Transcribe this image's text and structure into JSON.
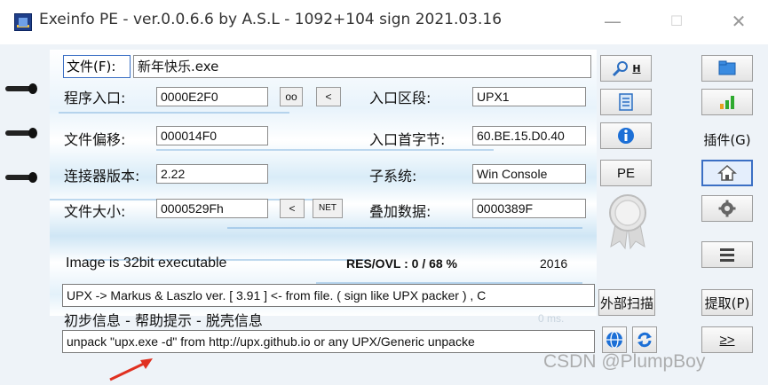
{
  "window": {
    "title": "Exeinfo PE - ver.0.0.6.6  by A.S.L -  1092+104 sign  2021.03.16",
    "minimize": "—",
    "maximize": "☐",
    "close": "✕"
  },
  "file": {
    "button_label": "文件(F):",
    "name": "新年快乐.exe"
  },
  "fields": {
    "entry_point_label": "程序入口:",
    "entry_point_value": "0000E2F0",
    "oo_button": "oo",
    "lt_button": "<",
    "entry_section_label": "入口区段:",
    "entry_section_value": "UPX1",
    "file_offset_label": "文件偏移:",
    "file_offset_value": "000014F0",
    "first_bytes_label": "入口首字节:",
    "first_bytes_value": "60.BE.15.D0.40",
    "linker_label": "连接器版本:",
    "linker_value": "2.22",
    "subsystem_label": "子系统:",
    "subsystem_value": "Win Console",
    "file_size_label": "文件大小:",
    "file_size_value": "0000529Fh",
    "lt2_button": "<",
    "net_button": "NET",
    "overlay_label": "叠加数据:",
    "overlay_value": "0000389F"
  },
  "status": {
    "image_text": "Image is 32bit executable",
    "res_ovl": "RES/OVL : 0 / 68 %",
    "year": "2016"
  },
  "detection": {
    "result": "UPX -> Markus & Laszlo ver. [ 3.91 ] <- from file. ( sign like UPX packer ) , C",
    "hint_label": "初步信息 - 帮助提示 - 脱壳信息",
    "time": "0 ms.",
    "unpack_hint": "unpack \"upx.exe -d\"  from  http://upx.github.io or any UPX/Generic unpacke"
  },
  "buttons": {
    "search_hotkey": "H",
    "pe": "PE",
    "external_scan": "外部扫描",
    "plugins": "插件(G)",
    "extract": "提取(P)",
    "next": "≥>"
  },
  "watermark": "CSDN @PlumpBoy",
  "colors": {
    "accent": "#3b6fc4",
    "arrow": "#e03020",
    "info_blue": "#1c6fd6"
  }
}
